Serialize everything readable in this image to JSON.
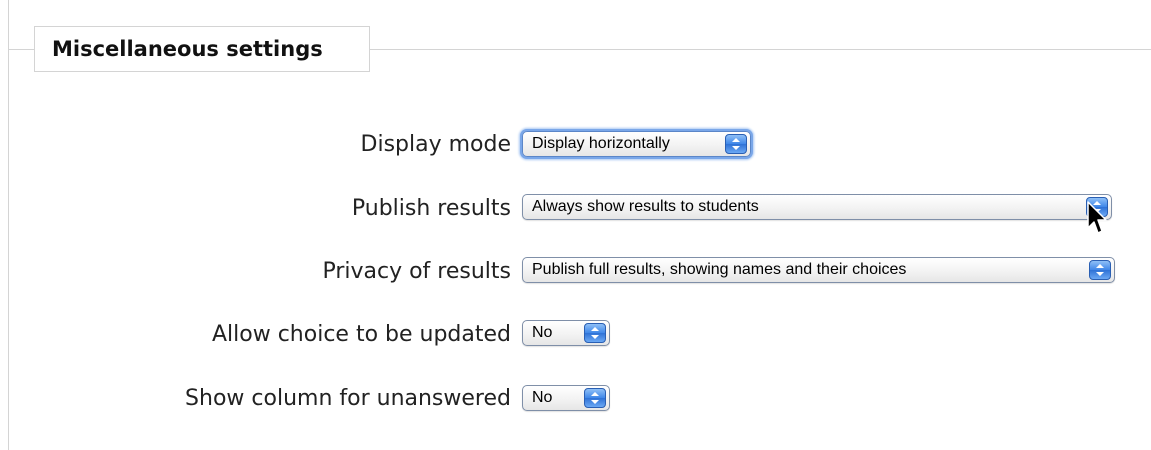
{
  "fieldset": {
    "legend": "Miscellaneous settings"
  },
  "fields": {
    "display_mode": {
      "label": "Display mode",
      "value": "Display horizontally"
    },
    "publish_results": {
      "label": "Publish results",
      "value": "Always show results to students"
    },
    "privacy_of_results": {
      "label": "Privacy of results",
      "value": "Publish full results, showing names and their choices"
    },
    "allow_update": {
      "label": "Allow choice to be updated",
      "value": "No"
    },
    "show_unanswered": {
      "label": "Show column for unanswered",
      "value": "No"
    }
  },
  "icons": {
    "select_arrows": "up-down-arrows-icon",
    "pointer": "mouse-pointer-icon"
  },
  "colors": {
    "focus_ring": "#7aa7e9",
    "arrow_button": "#3f86e8"
  }
}
